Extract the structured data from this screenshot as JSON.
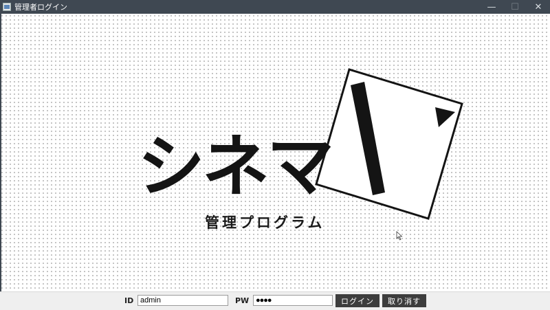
{
  "window": {
    "title": "管理者ログイン",
    "controls": [
      "minimize",
      "maximize",
      "close"
    ]
  },
  "logo": {
    "text": "シネマ",
    "subtitle": "管理プログラム",
    "mark_icon": "ticket-stub-icon"
  },
  "login": {
    "id_label": "ID",
    "id_value": "admin",
    "pw_label": "PW",
    "pw_value": "●●●●",
    "login_button": "ログイン",
    "cancel_button": "取り消す"
  },
  "colors": {
    "titlebar": "#3f4852",
    "logo_ink": "#141414",
    "button": "#3d3d3d",
    "bottombar": "#efefef"
  }
}
